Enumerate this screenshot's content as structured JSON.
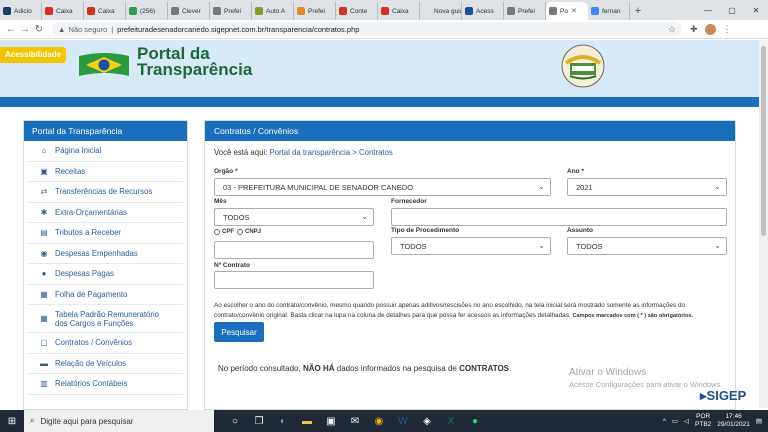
{
  "browser": {
    "tabs": [
      {
        "label": "Adicio",
        "color": "#1e3a6e"
      },
      {
        "label": "Caixa",
        "color": "#d93025"
      },
      {
        "label": "Caixa",
        "color": "#d93025"
      },
      {
        "label": "(256)",
        "color": "#2e9e4e"
      },
      {
        "label": "Clever",
        "color": "#777"
      },
      {
        "label": "Prefei",
        "color": "#777"
      },
      {
        "label": "Auto A",
        "color": "#8a9a2a"
      },
      {
        "label": "Prefei",
        "color": "#e08a20"
      },
      {
        "label": "Conte",
        "color": "#d93025"
      },
      {
        "label": "Caixa",
        "color": "#d93025"
      },
      {
        "label": "Nova guia",
        "color": "#dee1e6"
      },
      {
        "label": "Acess",
        "color": "#1a4fa0"
      },
      {
        "label": "Prefei",
        "color": "#777"
      },
      {
        "label": "Po",
        "color": "#777",
        "active": true
      },
      {
        "label": "fernan",
        "color": "#4285f4"
      }
    ],
    "security_label": "Não seguro",
    "url": "prefeituradesenadorcanedo.sigepnet.com.br/transparencia/contratos.php"
  },
  "header": {
    "accessibility_label": "Acessibilidade",
    "title_line1": "Portal da",
    "title_line2": "Transparência"
  },
  "sidebar": {
    "title": "Portal da Transparência",
    "items": [
      {
        "label": "Página Inicial",
        "icon": "home-icon",
        "glyph": "⌂"
      },
      {
        "label": "Receitas",
        "icon": "money-icon",
        "glyph": "▣"
      },
      {
        "label": "Transferências de Recursos",
        "icon": "transfer-icon",
        "glyph": "⇄"
      },
      {
        "label": "Extra-Orçamentárias",
        "icon": "gear-icon",
        "glyph": "✱"
      },
      {
        "label": "Tributos a Receber",
        "icon": "document-icon",
        "glyph": "▤"
      },
      {
        "label": "Despesas Empenhadas",
        "icon": "coins-icon",
        "glyph": "◉"
      },
      {
        "label": "Despesas Pagas",
        "icon": "paid-icon",
        "glyph": "●"
      },
      {
        "label": "Folha de Pagamento",
        "icon": "id-card-icon",
        "glyph": "▦"
      },
      {
        "label": "Tabela Padrão Remuneratório dos Cargos e Funções",
        "icon": "table-icon",
        "glyph": "▦"
      },
      {
        "label": "Contratos / Convênios",
        "icon": "contract-icon",
        "glyph": "▢"
      },
      {
        "label": "Relação de Veículos",
        "icon": "car-icon",
        "glyph": "▬"
      },
      {
        "label": "Relatórios Contábeis",
        "icon": "report-icon",
        "glyph": "▥"
      }
    ]
  },
  "panel": {
    "title": "Contratos / Convênios",
    "breadcrumb_prefix": "Você está aqui:",
    "breadcrumb_link": "Portal da transparência > Contratos",
    "orgao_label": "Orgão *",
    "orgao_value": "03 - PREFEITURA MUNICIPAL DE SENADOR CANEDO",
    "ano_label": "Ano *",
    "ano_value": "2021",
    "mes_label": "Mês",
    "mes_value": "TODOS",
    "fornecedor_label": "Fornecedor",
    "cpf_label": "CPF",
    "cnpj_label": "CNPJ",
    "tipo_label": "Tipo de Procedimento",
    "tipo_value": "TODOS",
    "assunto_label": "Assunto",
    "assunto_value": "TODOS",
    "contrato_label": "Nº Contrato",
    "note": "Ao escolher o ano do contrato/convênio, mesmo quando possuir apenas aditivos/rescisões no ano escolhido, na tela inicial será mostrado somente as informações do contrato/convênio original. Basta clicar na lupa na coluna de detalhes para que possa fer acessos as informações detalhadas.",
    "note_required": "Campos marcados com ( * ) são obrigatórios.",
    "search_button": "Pesquisar",
    "result_prefix": "No período consultado,",
    "result_bold1": "NÃO HÁ",
    "result_mid": "dados informados na pesquisa de",
    "result_bold2": "CONTRATOS",
    "result_end": "."
  },
  "watermark": {
    "line1": "Ativar o Windows",
    "line2": "Acesse Configurações para ativar o Windows."
  },
  "brand": "SIGEP",
  "taskbar": {
    "search_placeholder": "Digite aqui para pesquisar",
    "lang1": "POR",
    "lang2": "PTB2",
    "time": "17:46",
    "date": "29/01/2021"
  }
}
